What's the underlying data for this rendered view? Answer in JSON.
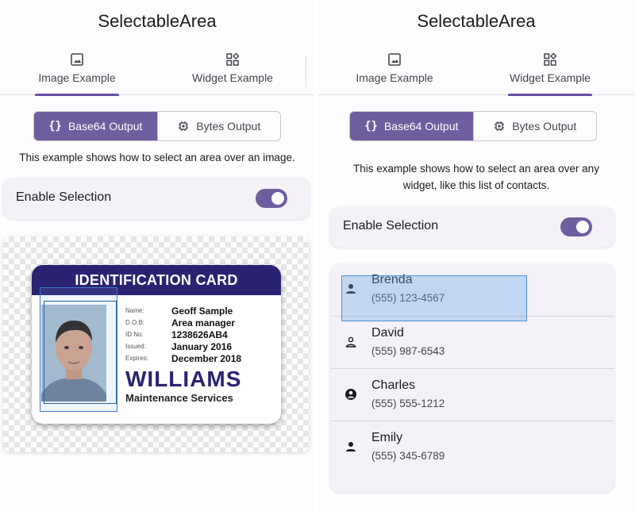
{
  "left": {
    "title": "SelectableArea",
    "tabs": [
      {
        "label": "Image Example",
        "icon": "image-icon",
        "selected": true
      },
      {
        "label": "Widget Example",
        "icon": "widgets-icon",
        "selected": false
      }
    ],
    "segmented": [
      {
        "label": "Base64 Output",
        "icon": "{}",
        "selected": true
      },
      {
        "label": "Bytes Output",
        "icon": "chip-icon",
        "selected": false
      }
    ],
    "description": "This example shows how to select an area over an image.",
    "toggle": {
      "label": "Enable Selection",
      "on": true
    },
    "id_card": {
      "header": "IDENTIFICATION CARD",
      "fields": [
        {
          "key": "Name:",
          "value": "Geoff Sample"
        },
        {
          "key": "D.O.B:",
          "value": "Area manager"
        },
        {
          "key": "ID No:",
          "value": "1238626AB4"
        },
        {
          "key": "Issued:",
          "value": "January 2016"
        },
        {
          "key": "Expires:",
          "value": "December 2018"
        }
      ],
      "brand": "WILLIAMS",
      "brand_sub": "Maintenance Services"
    }
  },
  "right": {
    "title": "SelectableArea",
    "tabs": [
      {
        "label": "Image Example",
        "icon": "image-icon",
        "selected": false
      },
      {
        "label": "Widget Example",
        "icon": "widgets-icon",
        "selected": true
      }
    ],
    "segmented": [
      {
        "label": "Base64 Output",
        "icon": "{}",
        "selected": true
      },
      {
        "label": "Bytes Output",
        "icon": "chip-icon",
        "selected": false
      }
    ],
    "description": "This example shows how to select an area over any widget, like this list of contacts.",
    "toggle": {
      "label": "Enable Selection",
      "on": true
    },
    "contacts": [
      {
        "name": "Brenda",
        "phone": "(555) 123-4567",
        "icon": "person-filled-icon"
      },
      {
        "name": "David",
        "phone": "(555) 987-6543",
        "icon": "person-outline-icon"
      },
      {
        "name": "Charles",
        "phone": "(555) 555-1212",
        "icon": "account-circle-icon"
      },
      {
        "name": "Emily",
        "phone": "(555) 345-6789",
        "icon": "person-filled-icon"
      }
    ]
  },
  "colors": {
    "primary": "#6e5e9e",
    "card_header": "#2a2371",
    "selection": "#4f8fd6"
  }
}
